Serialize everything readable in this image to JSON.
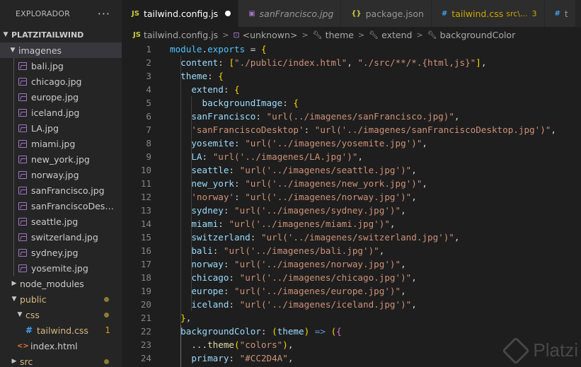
{
  "sidebar": {
    "title": "EXPLORADOR",
    "more": "···",
    "project": "PLATZITAILWIND",
    "folder_imagenes": "imagenes",
    "images": [
      "bali.jpg",
      "chicago.jpg",
      "europe.jpg",
      "iceland.jpg",
      "LA.jpg",
      "miami.jpg",
      "new_york.jpg",
      "norway.jpg",
      "sanFrancisco.jpg",
      "sanFranciscoDesktop.jpg",
      "seattle.jpg",
      "switzerland.jpg",
      "sydney.jpg",
      "yosemite.jpg"
    ],
    "node_modules": "node_modules",
    "public": "public",
    "css": "css",
    "tailwind_css": "tailwind.css",
    "tailwind_css_count": "1",
    "index_html": "index.html",
    "src": "src"
  },
  "tabs": [
    {
      "icon": "JS",
      "name": "tailwind.config.js",
      "active": true,
      "dirty": true
    },
    {
      "icon": "▣",
      "name": "sanFrancisco.jpg",
      "italic": true
    },
    {
      "icon": "{}",
      "name": "package.json"
    },
    {
      "icon": "#",
      "name": "tailwind.css",
      "extra": "src\\...",
      "count": "3"
    },
    {
      "icon": "#",
      "name": "t"
    }
  ],
  "breadcrumb": {
    "file_icon": "JS",
    "file": "tailwind.config.js",
    "unknown": "<unknown>",
    "theme": "theme",
    "extend": "extend",
    "backgroundColor": "backgroundColor"
  },
  "code_lines": [
    {
      "n": "1",
      "t": "module.exports = {"
    },
    {
      "n": "2",
      "t": "  content: [\"./public/index.html\", \"./src/**/*.{html,js}\"],"
    },
    {
      "n": "3",
      "t": "  theme: {"
    },
    {
      "n": "4",
      "t": "    extend: {"
    },
    {
      "n": "5",
      "t": "      backgroundImage: {"
    },
    {
      "n": "6",
      "t": "    sanFrancisco: \"url(../imagenes/sanFrancisco.jpg)\","
    },
    {
      "n": "7",
      "t": "    'sanFranciscoDesktop': \"url('../imagenes/sanFranciscoDesktop.jpg')\","
    },
    {
      "n": "8",
      "t": "    yosemite: \"url('../imagenes/yosemite.jpg')\","
    },
    {
      "n": "9",
      "t": "    LA: \"url('../imagenes/LA.jpg')\","
    },
    {
      "n": "10",
      "t": "    seattle: \"url('../imagenes/seattle.jpg')\","
    },
    {
      "n": "11",
      "t": "    new_york: \"url('../imagenes/new_york.jpg')\","
    },
    {
      "n": "12",
      "t": "    'norway': \"url('../imagenes/norway.jpg')\","
    },
    {
      "n": "13",
      "t": "    sydney: \"url('../imagenes/sydney.jpg')\","
    },
    {
      "n": "14",
      "t": "    miami: \"url('../imagenes/miami.jpg')\","
    },
    {
      "n": "15",
      "t": "    switzerland: \"url('../imagenes/switzerland.jpg')\","
    },
    {
      "n": "16",
      "t": "    bali: \"url('../imagenes/bali.jpg')\","
    },
    {
      "n": "17",
      "t": "    norway: \"url('../imagenes/norway.jpg')\","
    },
    {
      "n": "18",
      "t": "    chicago: \"url('../imagenes/chicago.jpg')\","
    },
    {
      "n": "19",
      "t": "    europe: \"url('../imagenes/europe.jpg')\","
    },
    {
      "n": "20",
      "t": "    iceland: \"url('../imagenes/iceland.jpg')\","
    },
    {
      "n": "21",
      "t": "  },"
    },
    {
      "n": "22",
      "t": "  backgroundColor: (theme) => ({"
    },
    {
      "n": "23",
      "t": "    ...theme(\"colors\"),"
    },
    {
      "n": "24",
      "t": "    primary: \"#CC2D4A\","
    }
  ],
  "watermark": "Platzi",
  "colors": {
    "editor_bg": "#1e1e1e",
    "sidebar_bg": "#252526",
    "string": "#ce9178",
    "property": "#9cdcfe",
    "bracket_gold": "#ffd700",
    "bracket_violet": "#da70d6",
    "bracket_blue": "#179fff"
  }
}
